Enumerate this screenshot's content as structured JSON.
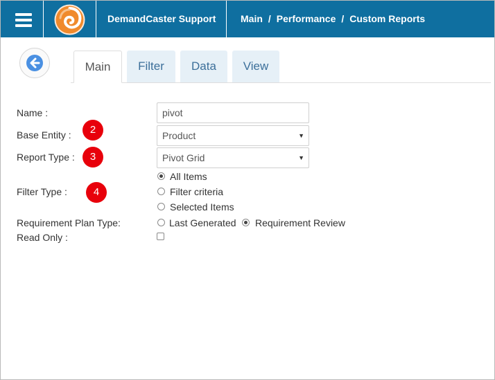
{
  "header": {
    "app_title": "DemandCaster Support",
    "breadcrumb": [
      "Main",
      "Performance",
      "Custom Reports"
    ],
    "breadcrumb_separator": "/",
    "color": "#0f6fa0"
  },
  "tabs": [
    {
      "label": "Main",
      "active": true
    },
    {
      "label": "Filter",
      "active": false
    },
    {
      "label": "Data",
      "active": false
    },
    {
      "label": "View",
      "active": false
    }
  ],
  "form": {
    "name": {
      "label": "Name :",
      "value": "pivot"
    },
    "base_entity": {
      "label": "Base Entity :",
      "value": "Product",
      "badge": "2"
    },
    "report_type": {
      "label": "Report Type :",
      "value": "Pivot Grid",
      "badge": "3"
    },
    "filter_type": {
      "label": "Filter Type :",
      "badge": "4",
      "options": [
        {
          "label": "All Items",
          "checked": true
        },
        {
          "label": "Filter criteria",
          "checked": false
        },
        {
          "label": "Selected Items",
          "checked": false
        }
      ]
    },
    "requirement_plan_type": {
      "label": "Requirement Plan Type:",
      "options": [
        {
          "label": "Last Generated",
          "checked": false
        },
        {
          "label": "Requirement Review",
          "checked": true
        }
      ]
    },
    "read_only": {
      "label": "Read Only :",
      "checked": false
    }
  },
  "colors": {
    "badge": "#e8000b",
    "tab_inactive_bg": "#e6f0f7",
    "tab_text": "#3c6f9a",
    "back_arrow": "#4a90e2"
  }
}
